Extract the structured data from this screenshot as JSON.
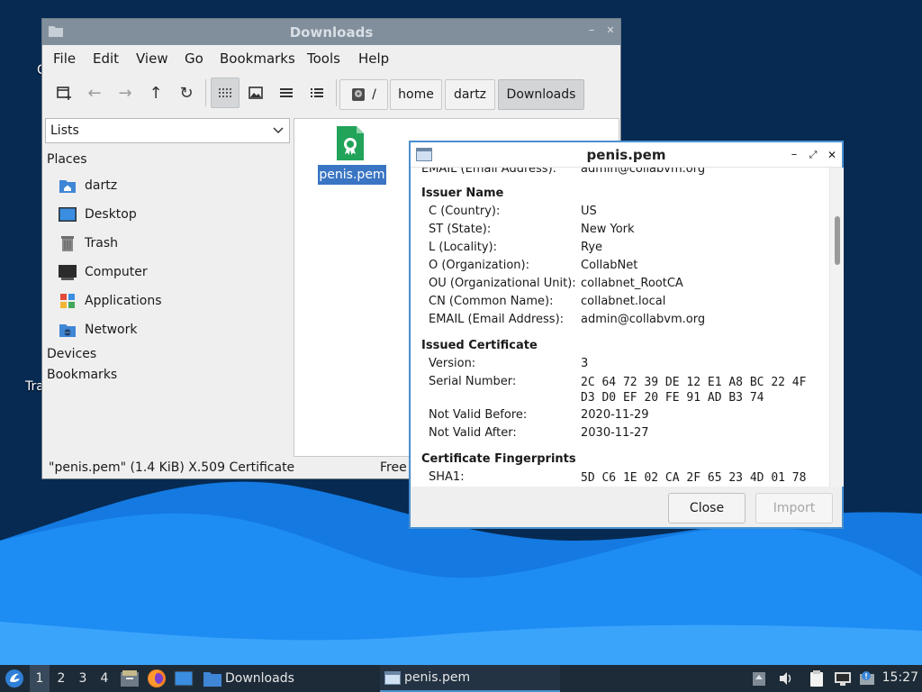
{
  "colors": {
    "desktop_dark": "#062a52",
    "wave_light": "#1f8bf2",
    "wave_mid": "#0f6fd8",
    "fm_titlebar": "#818f9c",
    "selection": "#3a75c4",
    "dialog_border": "#4a90d0",
    "taskbar": "#1d2b38"
  },
  "desktop": {
    "partial_labels": [
      "C",
      "Tra"
    ]
  },
  "file_manager": {
    "title": "Downloads",
    "menu": [
      "File",
      "Edit",
      "View",
      "Go",
      "Bookmarks",
      "Tools",
      "Help"
    ],
    "toolbar_icons": [
      "new-tab-icon",
      "back-icon",
      "forward-icon",
      "up-icon",
      "reload-icon",
      "icon-view-icon",
      "thumbnail-view-icon",
      "compact-view-icon",
      "detailed-list-icon"
    ],
    "breadcrumbs": {
      "root": "/",
      "items": [
        "home",
        "dartz",
        "Downloads"
      ]
    },
    "side_mode": "Lists",
    "places_header": "Places",
    "places": [
      {
        "label": "dartz",
        "icon": "home-folder-icon"
      },
      {
        "label": "Desktop",
        "icon": "desktop-icon"
      },
      {
        "label": "Trash",
        "icon": "trash-icon"
      },
      {
        "label": "Computer",
        "icon": "computer-icon"
      },
      {
        "label": "Applications",
        "icon": "applications-icon"
      },
      {
        "label": "Network",
        "icon": "network-icon"
      }
    ],
    "devices_header": "Devices",
    "bookmarks_header": "Bookmarks",
    "files": [
      {
        "name": "penis.pem",
        "icon": "certificate-file-icon",
        "selected": true
      }
    ],
    "status_left": "\"penis.pem\" (1.4 KiB) X.509 Certificate",
    "status_right": "Free"
  },
  "cert_dialog": {
    "title": "penis.pem",
    "partial_top_row": {
      "key": "EMAIL (Email Address):",
      "value": "admin@collabvm.org"
    },
    "issuer": {
      "heading": "Issuer Name",
      "rows": [
        {
          "key": "C (Country):",
          "value": "US"
        },
        {
          "key": "ST (State):",
          "value": "New York"
        },
        {
          "key": "L (Locality):",
          "value": "Rye"
        },
        {
          "key": "O (Organization):",
          "value": "CollabNet"
        },
        {
          "key": "OU (Organizational Unit):",
          "value": "collabnet_RootCA"
        },
        {
          "key": "CN (Common Name):",
          "value": "collabnet.local"
        },
        {
          "key": "EMAIL (Email Address):",
          "value": "admin@collabvm.org"
        }
      ]
    },
    "issued": {
      "heading": "Issued Certificate",
      "version_key": "Version:",
      "version": "3",
      "serial_key": "Serial Number:",
      "serial_line1": "2C 64 72 39 DE 12 E1 A8 BC 22 4F",
      "serial_line2": "D3 D0 EF 20 FE 91 AD B3 74",
      "not_before_key": "Not Valid Before:",
      "not_before": "2020-11-29",
      "not_after_key": "Not Valid After:",
      "not_after": "2030-11-27"
    },
    "fingerprints": {
      "heading": "Certificate Fingerprints",
      "sha1_key": "SHA1:",
      "sha1_partial": "5D C6 1E 02 CA 2F 65 23 4D 01 78"
    },
    "close_label": "Close",
    "import_label": "Import"
  },
  "taskbar": {
    "workspaces": [
      "1",
      "2",
      "3",
      "4"
    ],
    "active_workspace": "1",
    "tasks": [
      {
        "label": "Downloads",
        "icon": "folder-icon"
      },
      {
        "label": "penis.pem",
        "icon": "dialog-window-icon"
      }
    ],
    "clock": "15:27"
  }
}
